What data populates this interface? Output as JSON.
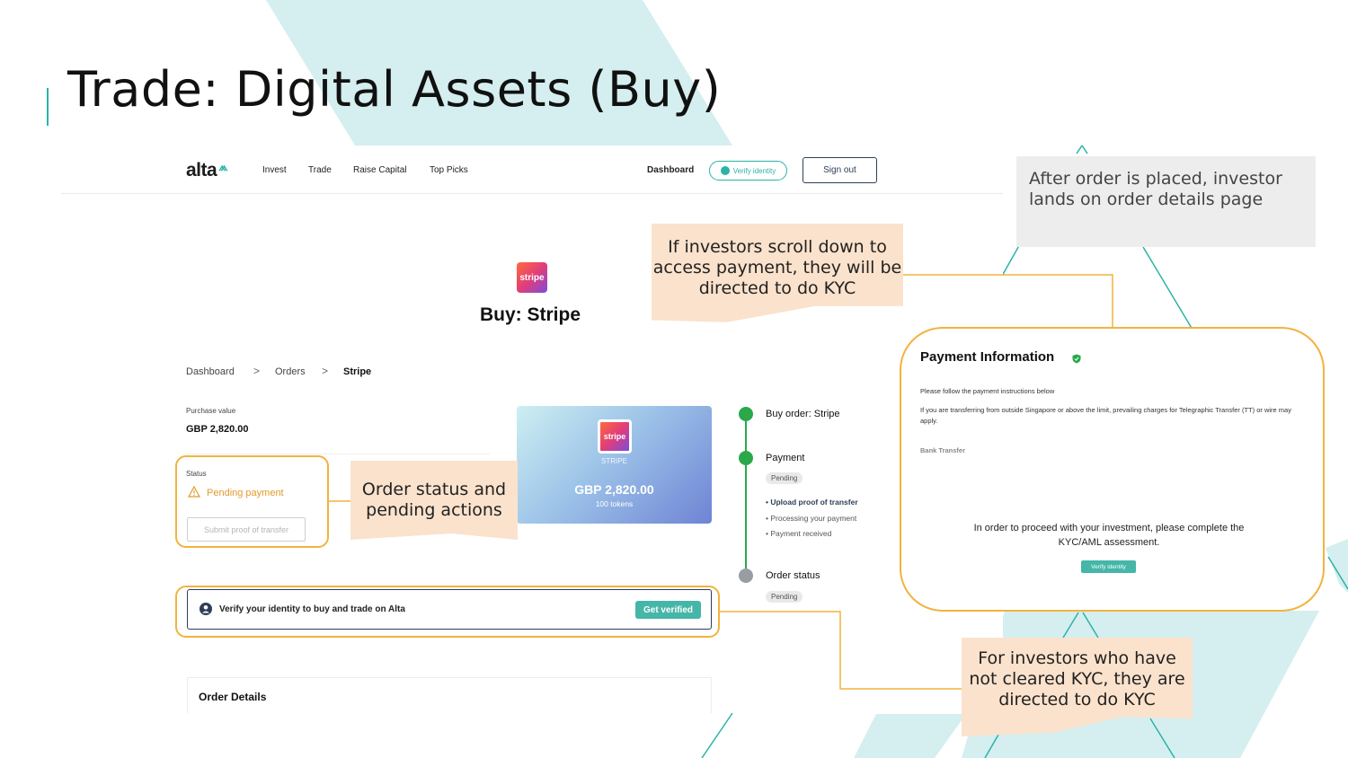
{
  "slide": {
    "title": "Trade: Digital Assets (Buy)"
  },
  "nav": {
    "logo": "alta",
    "logo_mark": "⩕",
    "links": [
      "Invest",
      "Trade",
      "Raise Capital",
      "Top Picks"
    ],
    "dashboard": "Dashboard",
    "verify_identity": "Verify identity",
    "sign_out": "Sign out"
  },
  "page": {
    "logo_text": "stripe",
    "title": "Buy: Stripe",
    "breadcrumb": [
      "Dashboard",
      "Orders",
      "Stripe"
    ],
    "breadcrumb_sep": ">"
  },
  "summary": {
    "purchase_label": "Purchase value",
    "purchase_value": "GBP 2,820.00",
    "status_label": "Status",
    "status_value": "Pending payment",
    "submit_button": "Submit proof of transfer"
  },
  "card": {
    "logo_text": "stripe",
    "name": "STRIPE",
    "amount": "GBP 2,820.00",
    "tokens": "100 tokens"
  },
  "steps": {
    "buy_order": "Buy order: Stripe",
    "payment": "Payment",
    "payment_status": "Pending",
    "substeps": [
      "Upload proof of transfer",
      "Processing your payment",
      "Payment received"
    ],
    "order_status": "Order status",
    "order_status_value": "Pending"
  },
  "verify_bar": {
    "text": "Verify your identity to buy and trade on Alta",
    "button": "Get verified"
  },
  "order_details": {
    "title": "Order Details"
  },
  "payment_info": {
    "title": "Payment Information",
    "instructions": "Please follow the payment instructions below",
    "note": "If you are transferring from outside Singapore or above the limit, prevailing charges for Telegraphic Transfer (TT) or wire may apply.",
    "bank_transfer": "Bank Transfer",
    "kyc_message": "In order to proceed with your investment, please complete the KYC/AML assessment.",
    "verify_button": "Verify identity"
  },
  "annotations": {
    "order_status_note": "Order status and pending actions",
    "scroll_note": "If investors scroll down to access payment, they will be directed to do KYC",
    "after_order_note": "After order is placed, investor lands on order details page",
    "kyc_note": "For investors who have not cleared KYC, they are directed to do KYC"
  },
  "colors": {
    "accent_teal": "#2bb3a8",
    "highlight_orange": "#f2b33d",
    "note_peach": "#fbe2cc",
    "step_green": "#2aa84a",
    "pending_orange": "#e39a2b",
    "bg_teal_light": "#d5eef0"
  }
}
